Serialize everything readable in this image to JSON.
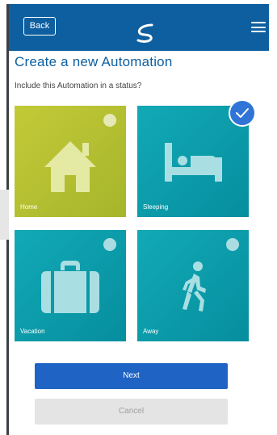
{
  "header": {
    "back_label": "Back"
  },
  "page": {
    "title": "Create a new Automation",
    "prompt": "Include this Automation in a status?"
  },
  "statuses": [
    {
      "label": "Home",
      "icon": "house-icon",
      "selected": false,
      "color": "#b5bf31"
    },
    {
      "label": "Sleeping",
      "icon": "bed-icon",
      "selected": true,
      "color": "#0c9fad"
    },
    {
      "label": "Vacation",
      "icon": "suitcase-icon",
      "selected": false,
      "color": "#0c9fad"
    },
    {
      "label": "Away",
      "icon": "walking-person-icon",
      "selected": false,
      "color": "#0c9fad"
    }
  ],
  "actions": {
    "next_label": "Next",
    "cancel_label": "Cancel"
  },
  "colors": {
    "header": "#0d5fa0",
    "primary_button": "#1f63c4",
    "check_badge": "#2f74d6"
  }
}
